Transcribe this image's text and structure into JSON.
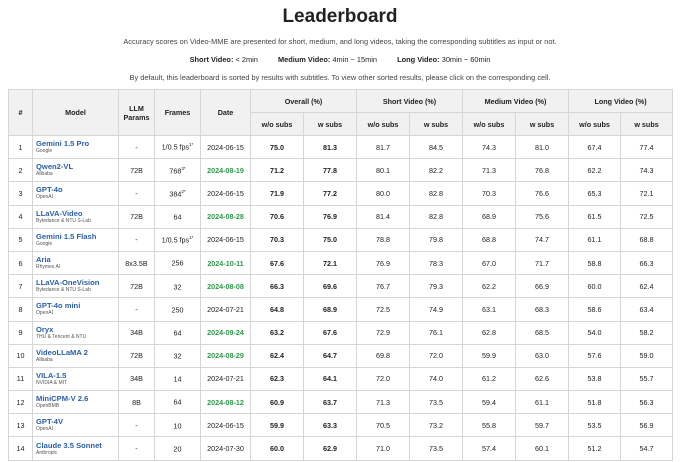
{
  "title": "Leaderboard",
  "description": "Accuracy scores on Video-MME are presented for short, medium, and long videos, taking the corresponding subtitles as input or not.",
  "legend": [
    {
      "label": "Short Video:",
      "value": "< 2min"
    },
    {
      "label": "Medium Video:",
      "value": "4min ~ 15min"
    },
    {
      "label": "Long Video:",
      "value": "30min ~ 60min"
    }
  ],
  "sort_note": "By default, this leaderboard is sorted by results with subtitles. To view other sorted results, please click on the corresponding cell.",
  "headers": {
    "rank": "#",
    "model": "Model",
    "llm_params": "LLM Params",
    "frames": "Frames",
    "date": "Date",
    "overall": "Overall (%)",
    "short": "Short Video (%)",
    "medium": "Medium Video (%)",
    "long": "Long Video (%)",
    "wo_subs": "w/o subs",
    "w_subs": "w subs"
  },
  "rows": [
    {
      "rank": "1",
      "name": "Gemini 1.5 Pro",
      "org": "Google",
      "params": "-",
      "frames": "1/0.5 fps",
      "frames_sup": "1*",
      "date": "2024-06-15",
      "date_new": false,
      "ov_wo": "75.0",
      "ov_w": "81.3",
      "s_wo": "81.7",
      "s_w": "84.5",
      "m_wo": "74.3",
      "m_w": "81.0",
      "l_wo": "67.4",
      "l_w": "77.4"
    },
    {
      "rank": "2",
      "name": "Qwen2-VL",
      "org": "Alibaba",
      "params": "72B",
      "frames": "768",
      "frames_sup": "3*",
      "date": "2024-08-19",
      "date_new": true,
      "ov_wo": "71.2",
      "ov_w": "77.8",
      "s_wo": "80.1",
      "s_w": "82.2",
      "m_wo": "71.3",
      "m_w": "76.8",
      "l_wo": "62.2",
      "l_w": "74.3"
    },
    {
      "rank": "3",
      "name": "GPT-4o",
      "org": "OpenAI",
      "params": "-",
      "frames": "384",
      "frames_sup": "2*",
      "date": "2024-06-15",
      "date_new": false,
      "ov_wo": "71.9",
      "ov_w": "77.2",
      "s_wo": "80.0",
      "s_w": "82.8",
      "m_wo": "70.3",
      "m_w": "76.6",
      "l_wo": "65.3",
      "l_w": "72.1"
    },
    {
      "rank": "4",
      "name": "LLaVA-Video",
      "org": "Bytedance & NTU S-Lab",
      "params": "72B",
      "frames": "64",
      "frames_sup": "",
      "date": "2024-08-28",
      "date_new": true,
      "ov_wo": "70.6",
      "ov_w": "76.9",
      "s_wo": "81.4",
      "s_w": "82.8",
      "m_wo": "68.9",
      "m_w": "75.6",
      "l_wo": "61.5",
      "l_w": "72.5"
    },
    {
      "rank": "5",
      "name": "Gemini 1.5 Flash",
      "org": "Google",
      "params": "-",
      "frames": "1/0.5 fps",
      "frames_sup": "1*",
      "date": "2024-06-15",
      "date_new": false,
      "ov_wo": "70.3",
      "ov_w": "75.0",
      "s_wo": "78.8",
      "s_w": "79.8",
      "m_wo": "68.8",
      "m_w": "74.7",
      "l_wo": "61.1",
      "l_w": "68.8"
    },
    {
      "rank": "6",
      "name": "Aria",
      "org": "Rhymes AI",
      "params": "8x3.5B",
      "frames": "256",
      "frames_sup": "",
      "date": "2024-10-11",
      "date_new": true,
      "ov_wo": "67.6",
      "ov_w": "72.1",
      "s_wo": "76.9",
      "s_w": "78.3",
      "m_wo": "67.0",
      "m_w": "71.7",
      "l_wo": "58.8",
      "l_w": "66.3"
    },
    {
      "rank": "7",
      "name": "LLaVA-OneVision",
      "org": "Bytedance & NTU S-Lab",
      "params": "72B",
      "frames": "32",
      "frames_sup": "",
      "date": "2024-08-08",
      "date_new": true,
      "ov_wo": "66.3",
      "ov_w": "69.6",
      "s_wo": "76.7",
      "s_w": "79.3",
      "m_wo": "62.2",
      "m_w": "66.9",
      "l_wo": "60.0",
      "l_w": "62.4"
    },
    {
      "rank": "8",
      "name": "GPT-4o mini",
      "org": "OpenAI",
      "params": "-",
      "frames": "250",
      "frames_sup": "",
      "date": "2024-07-21",
      "date_new": false,
      "ov_wo": "64.8",
      "ov_w": "68.9",
      "s_wo": "72.5",
      "s_w": "74.9",
      "m_wo": "63.1",
      "m_w": "68.3",
      "l_wo": "58.6",
      "l_w": "63.4"
    },
    {
      "rank": "9",
      "name": "Oryx",
      "org": "THU & Tencent & NTU",
      "params": "34B",
      "frames": "64",
      "frames_sup": "",
      "date": "2024-09-24",
      "date_new": true,
      "ov_wo": "63.2",
      "ov_w": "67.6",
      "s_wo": "72.9",
      "s_w": "76.1",
      "m_wo": "62.8",
      "m_w": "68.5",
      "l_wo": "54.0",
      "l_w": "58.2"
    },
    {
      "rank": "10",
      "name": "VideoLLaMA 2",
      "org": "Alibaba",
      "params": "72B",
      "frames": "32",
      "frames_sup": "",
      "date": "2024-08-29",
      "date_new": true,
      "ov_wo": "62.4",
      "ov_w": "64.7",
      "s_wo": "69.8",
      "s_w": "72.0",
      "m_wo": "59.9",
      "m_w": "63.0",
      "l_wo": "57.6",
      "l_w": "59.0"
    },
    {
      "rank": "11",
      "name": "VILA-1.5",
      "org": "NVIDIA & MIT",
      "params": "34B",
      "frames": "14",
      "frames_sup": "",
      "date": "2024-07-21",
      "date_new": false,
      "ov_wo": "62.3",
      "ov_w": "64.1",
      "s_wo": "72.0",
      "s_w": "74.0",
      "m_wo": "61.2",
      "m_w": "62.6",
      "l_wo": "53.8",
      "l_w": "55.7"
    },
    {
      "rank": "12",
      "name": "MiniCPM-V 2.6",
      "org": "OpenBMB",
      "params": "8B",
      "frames": "64",
      "frames_sup": "",
      "date": "2024-08-12",
      "date_new": true,
      "ov_wo": "60.9",
      "ov_w": "63.7",
      "s_wo": "71.3",
      "s_w": "73.5",
      "m_wo": "59.4",
      "m_w": "61.1",
      "l_wo": "51.8",
      "l_w": "56.3"
    },
    {
      "rank": "13",
      "name": "GPT-4V",
      "org": "OpenAI",
      "params": "-",
      "frames": "10",
      "frames_sup": "",
      "date": "2024-06-15",
      "date_new": false,
      "ov_wo": "59.9",
      "ov_w": "63.3",
      "s_wo": "70.5",
      "s_w": "73.2",
      "m_wo": "55.8",
      "m_w": "59.7",
      "l_wo": "53.5",
      "l_w": "56.9"
    },
    {
      "rank": "14",
      "name": "Claude 3.5 Sonnet",
      "org": "Anthropic",
      "params": "-",
      "frames": "20",
      "frames_sup": "",
      "date": "2024-07-30",
      "date_new": false,
      "ov_wo": "60.0",
      "ov_w": "62.9",
      "s_wo": "71.0",
      "s_w": "73.5",
      "m_wo": "57.4",
      "m_w": "60.1",
      "l_wo": "51.2",
      "l_w": "54.7"
    }
  ],
  "colors": {
    "link": "#2a5ea8",
    "new_date": "#2e9a4a",
    "header_bg": "#f1f1f1"
  }
}
